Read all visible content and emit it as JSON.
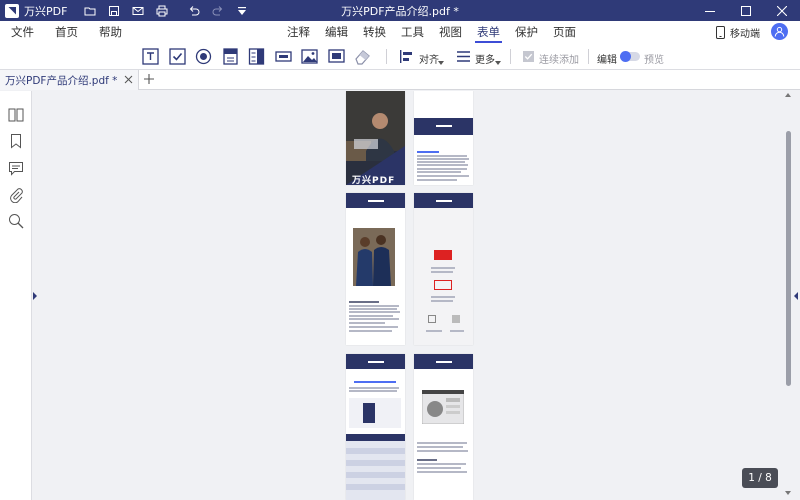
{
  "titlebar": {
    "app_name": "万兴PDF",
    "document_title": "万兴PDF产品介绍.pdf *"
  },
  "menubar": {
    "left": [
      "文件",
      "首页",
      "帮助"
    ],
    "center": [
      "注释",
      "编辑",
      "转换",
      "工具",
      "视图",
      "表单",
      "保护",
      "页面"
    ],
    "active": "表单",
    "mobile_label": "移动端"
  },
  "toolbar": {
    "align_label": "对齐",
    "more_label": "更多",
    "continuous_add_label": "连续添加",
    "edit_label": "编辑",
    "preview_label": "预览",
    "tool_icons": [
      "text-field-icon",
      "checkbox-icon",
      "radio-button-icon",
      "combo-box-icon",
      "list-box-icon",
      "button-field-icon",
      "image-field-icon",
      "signature-field-icon",
      "eraser-icon"
    ]
  },
  "tabs": [
    {
      "label": "万兴PDF产品介绍.pdf *"
    }
  ],
  "sidebar": {
    "icons": [
      "thumbnails-icon",
      "bookmark-icon",
      "comment-icon",
      "attachment-icon",
      "search-icon"
    ]
  },
  "document": {
    "cover_brand": "万兴PDF",
    "page_counter": "1 / 8"
  },
  "colors": {
    "titlebar": "#2f3a78",
    "accent": "#4e6ef2",
    "page_band": "#2b3466"
  }
}
